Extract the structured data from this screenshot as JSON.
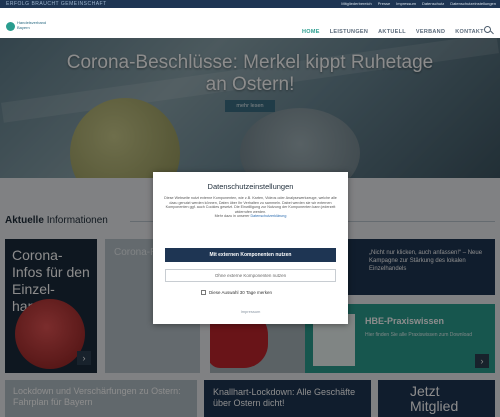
{
  "topbar": {
    "slogan": "ERFOLG BRAUCHT GEMEINSCHAFT",
    "links": [
      "Mitgliederbereich",
      "Presse",
      "Impressum",
      "Datenschutz",
      "Datenschutzeinstellungen"
    ]
  },
  "header": {
    "logo_text": "Handelsverband Bayern"
  },
  "nav": {
    "items": [
      {
        "label": "HOME",
        "active": true
      },
      {
        "label": "LEISTUNGEN",
        "active": false
      },
      {
        "label": "AKTUELL",
        "active": false
      },
      {
        "label": "VERBAND",
        "active": false
      },
      {
        "label": "KONTAKT",
        "active": false
      }
    ]
  },
  "hero": {
    "title_line1": "Corona-Beschlüsse: Merkel kippt Ruhetage",
    "title_line2": "an Ostern!",
    "button": "mehr lesen"
  },
  "section": {
    "title_bold": "Aktuelle",
    "title_rest": "Informationen"
  },
  "cards": {
    "c1_title": "Corona-Infos für den Einzel-handel",
    "c1_arrow": "›",
    "c2_title": "Corona-Ruhetage",
    "c4_title": "„Nicht nur klicken, auch anfassen!“ – Neue Kampagne zur Stärkung des lokalen Einzelhandels",
    "c5_title": "HBE-Praxiswissen",
    "c5_sub": "Hier finden Sie alle Praxiswissen zum Download",
    "c5_arrow": "›",
    "c6_title": "Lockdown und Verschärfungen zu Ostern: Fahrplan für Bayern",
    "c7_title": "Knallhart-Lockdown: Alle Geschäfte über Ostern dicht!",
    "c8_title": "Jetzt Mitglied"
  },
  "modal": {
    "title": "Datenschutzeinstellungen",
    "body": "Diese Webseite nutzt externe Komponenten, wie z.B. Karten, Videos oder Analysewerkzeuge, welche alle dazu genutzt werden können, Daten über Ihr Verhalten zu sammeln. Dabei werden sie wir externen Komponenten ggf. auch Cookies gesetzt. Die Einwilligung zur Nutzung der Komponenten kann jederzeit widerrufen werden.",
    "more_prefix": "Mehr dazu in unserer",
    "more_link": "Datenschutzerklärung",
    "btn_primary": "Mit externen Komponenten nutzen",
    "btn_secondary": "Ohne externe Komponenten nutzen",
    "checkbox_label": "Diese Auswahl 30 Tage merken",
    "imprint": "Impressum"
  },
  "colors": {
    "navy": "#1e3553",
    "teal": "#2a9d8f"
  }
}
